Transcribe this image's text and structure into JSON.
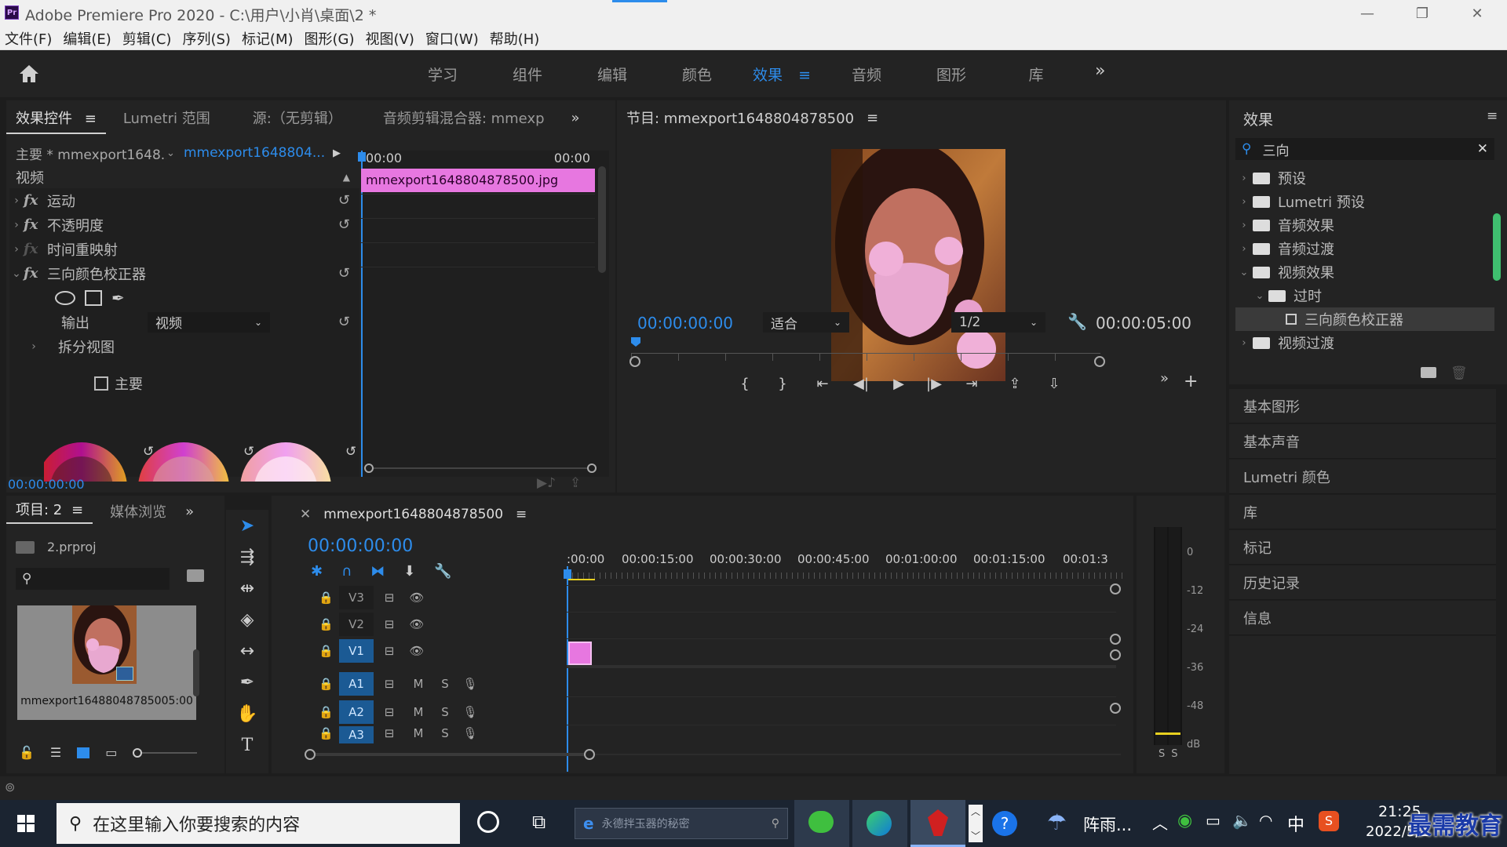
{
  "window": {
    "title": "Adobe Premiere Pro 2020 - C:\\用户\\小肖\\桌面\\2 *",
    "app_badge": "Pr",
    "minimize": "—",
    "restore": "❐",
    "close": "✕"
  },
  "menu": [
    "文件(F)",
    "编辑(E)",
    "剪辑(C)",
    "序列(S)",
    "标记(M)",
    "图形(G)",
    "视图(V)",
    "窗口(W)",
    "帮助(H)"
  ],
  "workspaces": {
    "tabs": [
      "学习",
      "组件",
      "编辑",
      "颜色",
      "效果",
      "音频",
      "图形",
      "库"
    ],
    "active": "效果",
    "menu_icon": "≡",
    "more": "»"
  },
  "effect_controls": {
    "tabs": [
      "效果控件",
      "Lumetri 范围",
      "源:（无剪辑）",
      "音频剪辑混合器: mmexp"
    ],
    "tab_menu": "≡",
    "more": "»",
    "master_clip": "主要 * mmexport1648...",
    "sequence_clip": "mmexport1648804...",
    "time_start": "00:00",
    "time_end": "00:00",
    "clip_name": "mmexport1648804878500.jpg",
    "section_video": "视频",
    "effects": [
      {
        "label": "运动",
        "fx": "fx",
        "dim": false
      },
      {
        "label": "不透明度",
        "fx": "fx",
        "dim": false
      },
      {
        "label": "时间重映射",
        "fx": "fx",
        "dim": true
      },
      {
        "label": "三向颜色校正器",
        "fx": "fx",
        "dim": false
      }
    ],
    "output_label": "输出",
    "output_value": "视频",
    "split_view_label": "拆分视图",
    "master_checkbox_label": "主要",
    "current_time": "00:00:00:00"
  },
  "program": {
    "title": "节目: mmexport1648804878500",
    "menu_icon": "≡",
    "timecode": "00:00:00:00",
    "fit": "适合",
    "resolution": "1/2",
    "duration": "00:00:05:00",
    "controls": [
      "{",
      "}",
      "⇤",
      "◀|",
      "▶",
      "|▶",
      "⇥",
      "⇪",
      "⇩"
    ],
    "more": "»",
    "add": "+"
  },
  "effects_panel": {
    "title": "效果",
    "menu_icon": "≡",
    "search_value": "三向",
    "clear": "✕",
    "tree": [
      {
        "label": "预设",
        "chev": "›",
        "indent": 0,
        "type": "star-folder"
      },
      {
        "label": "Lumetri 预设",
        "chev": "›",
        "indent": 0,
        "type": "star-folder"
      },
      {
        "label": "音频效果",
        "chev": "›",
        "indent": 0,
        "type": "folder"
      },
      {
        "label": "音频过渡",
        "chev": "›",
        "indent": 0,
        "type": "folder"
      },
      {
        "label": "视频效果",
        "chev": "⌄",
        "indent": 0,
        "type": "folder"
      },
      {
        "label": "过时",
        "chev": "⌄",
        "indent": 1,
        "type": "folder"
      },
      {
        "label": "三向颜色校正器",
        "chev": "",
        "indent": 2,
        "type": "effect",
        "selected": true
      },
      {
        "label": "视频过渡",
        "chev": "›",
        "indent": 0,
        "type": "folder"
      }
    ]
  },
  "side_panels": [
    "基本图形",
    "基本声音",
    "Lumetri 颜色",
    "库",
    "标记",
    "历史记录",
    "信息"
  ],
  "project": {
    "tabs": [
      "项目: 2",
      "媒体浏览"
    ],
    "menu_icon": "≡",
    "more": "»",
    "file": "2.prproj",
    "item_name": "mmexport16488048785005:00"
  },
  "timeline": {
    "close": "✕",
    "title": "mmexport1648804878500",
    "menu_icon": "≡",
    "timecode": "00:00:00:00",
    "ruler": [
      ":00:00",
      "00:00:15:00",
      "00:00:30:00",
      "00:00:45:00",
      "00:01:00:00",
      "00:01:15:00",
      "00:01:3"
    ],
    "video_tracks": [
      "V3",
      "V2",
      "V1"
    ],
    "audio_tracks": [
      "A1",
      "A2",
      "A3"
    ],
    "track_mute": "M",
    "track_solo": "S"
  },
  "meters": {
    "scale": [
      "0",
      "-12",
      "-24",
      "-36",
      "-48",
      "dB"
    ],
    "solo": [
      "S",
      "S"
    ]
  },
  "taskbar": {
    "search_placeholder": "在这里输入你要搜索的内容",
    "browser_search": "永德拌玉器的秘密",
    "weather": "阵雨...",
    "ime": "中",
    "time": "21:25",
    "date": "2022/5/2",
    "watermark": "最需教育"
  },
  "colors": {
    "accent": "#2d8ceb",
    "clip_pink": "#e777e0",
    "panel": "#232323",
    "background": "#1d1d1d"
  }
}
